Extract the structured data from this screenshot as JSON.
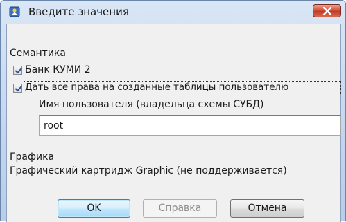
{
  "window": {
    "title": "Введите значения"
  },
  "semantics": {
    "heading": "Семантика",
    "checkbox_bank": {
      "label": "Банк КУМИ 2",
      "checked": true
    },
    "checkbox_rights": {
      "label": "Дать все права на созданные таблицы пользователю",
      "checked": true
    },
    "user_label": "Имя пользователя (владельца схемы СУБД)",
    "user_value": "root"
  },
  "graphics": {
    "heading": "Графика",
    "description": "Графический картридж Graphic (не поддерживается)"
  },
  "buttons": {
    "ok": "OK",
    "help": "Справка",
    "cancel": "Отмена"
  },
  "icons": {
    "app": "app-icon",
    "close": "close-icon",
    "check": "checkmark-icon"
  },
  "colors": {
    "frame": "#c4d6ee",
    "client": "#f0f0f0",
    "close_button": "#c23a22",
    "default_button_border": "#3c7fb1",
    "checkmark": "#2b4f8e"
  }
}
